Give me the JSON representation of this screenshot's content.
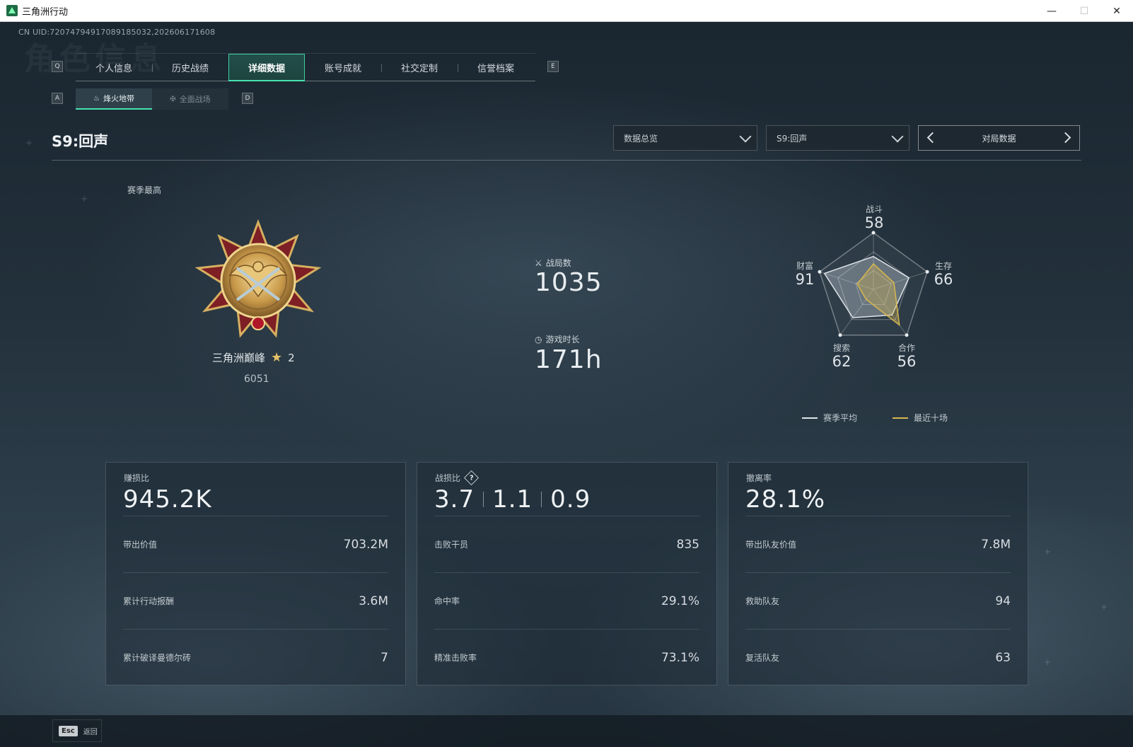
{
  "window": {
    "title": "三角洲行动"
  },
  "uid_text": "CN UID:7207479491708918503​2,202606171608",
  "watermark_text": "角色信息",
  "tabs": {
    "left_key": "Q",
    "right_key": "E",
    "items": [
      {
        "label": "个人信息",
        "active": false
      },
      {
        "label": "历史战绩",
        "active": false
      },
      {
        "label": "详细数据",
        "active": true
      },
      {
        "label": "账号成就",
        "active": false
      },
      {
        "label": "社交定制",
        "active": false
      },
      {
        "label": "信誉档案",
        "active": false
      }
    ]
  },
  "subtabs": {
    "left_key": "A",
    "right_key": "D",
    "items": [
      {
        "label": "烽火地带",
        "active": true
      },
      {
        "label": "全面战场",
        "active": false
      }
    ]
  },
  "header": {
    "season_title": "S9:回声",
    "dropdown_view": "数据总览",
    "dropdown_season": "S9:回声",
    "pager_label": "对局数据"
  },
  "rank": {
    "label": "赛季最高",
    "name": "三角洲巅峰",
    "stars": "2",
    "score": "6051"
  },
  "stats": {
    "matches_label": "战局数",
    "matches_value": "1035",
    "playtime_label": "游戏时长",
    "playtime_value": "171h"
  },
  "radar": {
    "axes": [
      {
        "label": "战斗",
        "value": 58
      },
      {
        "label": "生存",
        "value": 66
      },
      {
        "label": "合作",
        "value": 56
      },
      {
        "label": "搜索",
        "value": 62
      },
      {
        "label": "财富",
        "value": 91
      }
    ],
    "legend_avg": "赛季平均",
    "legend_recent": "最近十场",
    "color_avg": "#dfe4e8",
    "color_recent": "#d9b84f"
  },
  "cards": [
    {
      "title": "赚损比",
      "big": "945.2K",
      "rows": [
        {
          "label": "带出价值",
          "value": "703.2M"
        },
        {
          "label": "累计行动报酬",
          "value": "3.6M"
        },
        {
          "label": "累计破译曼德尔砖",
          "value": "7"
        }
      ]
    },
    {
      "title": "战损比",
      "big_parts": [
        "3.7",
        "1.1",
        "0.9"
      ],
      "help": "?",
      "rows": [
        {
          "label": "击败干员",
          "value": "835"
        },
        {
          "label": "命中率",
          "value": "29.1%"
        },
        {
          "label": "精准击败率",
          "value": "73.1%"
        }
      ]
    },
    {
      "title": "撤离率",
      "big": "28.1%",
      "rows": [
        {
          "label": "带出队友价值",
          "value": "7.8M"
        },
        {
          "label": "救助队友",
          "value": "94"
        },
        {
          "label": "复活队友",
          "value": "63"
        }
      ]
    }
  ],
  "footer": {
    "esc_key": "Esc",
    "esc_label": "返回"
  },
  "colors": {
    "accent": "#46e3b0",
    "gold": "#d9b84f"
  }
}
